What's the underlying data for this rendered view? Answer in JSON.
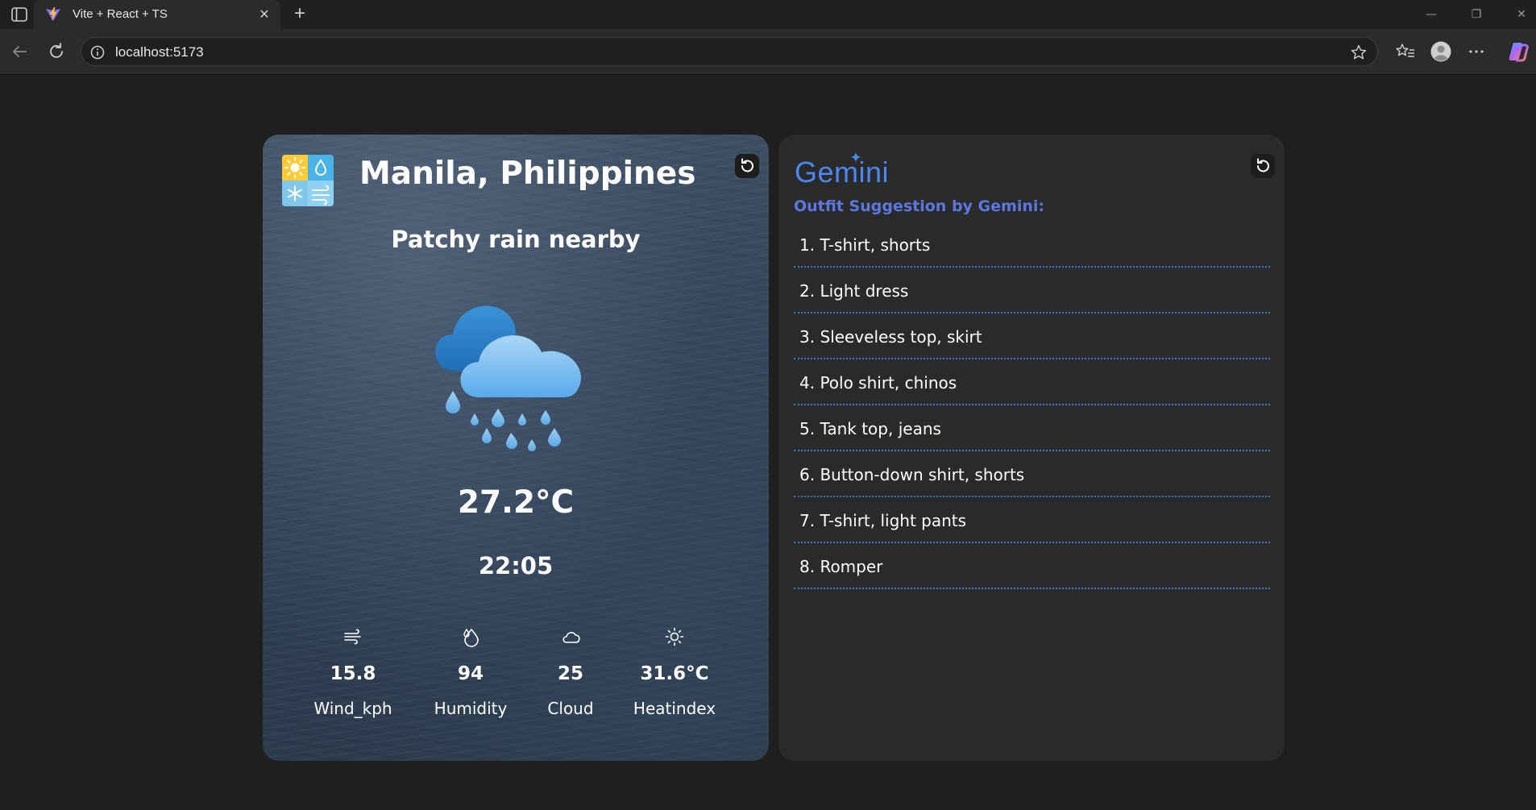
{
  "browser": {
    "tab_title": "Vite + React + TS",
    "url": "localhost:5173"
  },
  "weather": {
    "city": "Manila, Philippines",
    "condition": "Patchy rain nearby",
    "temperature": "27.2°C",
    "time": "22:05",
    "stats": [
      {
        "icon": "wind-icon",
        "value": "15.8",
        "label": "Wind_kph"
      },
      {
        "icon": "humidity-icon",
        "value": "94",
        "label": "Humidity"
      },
      {
        "icon": "cloud-icon",
        "value": "25",
        "label": "Cloud"
      },
      {
        "icon": "sun-icon",
        "value": "31.6°C",
        "label": "Heatindex"
      }
    ]
  },
  "gemini": {
    "logo_text": "Gemini",
    "subtitle": "Outfit Suggestion by Gemini:",
    "outfits": [
      "1. T-shirt, shorts",
      "2. Light dress",
      "3. Sleeveless top, skirt",
      "4. Polo shirt, chinos",
      "5. Tank top, jeans",
      "6. Button-down shirt, shorts",
      "7. T-shirt, light pants",
      "8. Romper"
    ]
  },
  "colors": {
    "page_bg": "#1f1f1f",
    "gemini_blue": "#4e87f2",
    "subtitle_purple_blue": "#5b78e0",
    "divider": "#3f79d8"
  }
}
